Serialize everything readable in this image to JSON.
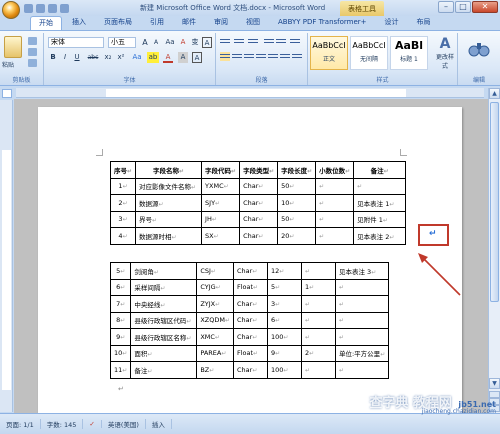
{
  "window": {
    "title": "新建 Microsoft Office Word 文档.docx - Microsoft Word",
    "context_tab_title": "表格工具",
    "minimize": "–",
    "maximize": "□",
    "close": "✕"
  },
  "tabs": [
    "开始",
    "插入",
    "页面布局",
    "引用",
    "邮件",
    "审阅",
    "视图",
    "ABBYY PDF Transformer+",
    "设计",
    "布局"
  ],
  "active_tab": "开始",
  "ribbon": {
    "clipboard": {
      "label": "剪贴板",
      "paste": "粘贴"
    },
    "font": {
      "label": "字体",
      "font_name": "宋体",
      "font_size": "小五",
      "grow": "A",
      "shrink": "A",
      "aa": "Aa",
      "clear": "A",
      "wen": "变",
      "wen2": "A",
      "bold": "B",
      "italic": "I",
      "underline": "U",
      "strike": "abc",
      "sub": "x₂",
      "sup": "x²",
      "effect": "Aa",
      "highlight": "ab",
      "color": "A",
      "char_border": "A",
      "char_shade": "A"
    },
    "paragraph": {
      "label": "段落"
    },
    "styles": {
      "label": "样式",
      "items": [
        {
          "sample": "AaBbCcI",
          "name": "正文",
          "selected": true
        },
        {
          "sample": "AaBbCcI",
          "name": "无间隔",
          "selected": false
        },
        {
          "sample": "AaBl",
          "name": "标题 1",
          "selected": false
        }
      ],
      "change_styles": "更改样式",
      "change_styles_glyph": "A"
    },
    "editing": {
      "label": "编辑"
    }
  },
  "table1": {
    "headers": [
      "序号",
      "字段名称",
      "字段代码",
      "字段类型",
      "字段长度",
      "小数位数",
      "备注"
    ],
    "rows": [
      [
        "1",
        "对应影像文件名称",
        "YXMC",
        "Char",
        "50",
        "",
        ""
      ],
      [
        "2",
        "数据源",
        "SJY",
        "Char",
        "10",
        "",
        "见本表注 1"
      ],
      [
        "3",
        "界号",
        "JH",
        "Char",
        "50",
        "",
        "见附件 1"
      ],
      [
        "4",
        "数据源时相",
        "SX",
        "Char",
        "20",
        "",
        "见本表注 2"
      ]
    ]
  },
  "table2": {
    "rows": [
      [
        "5",
        "剑阅角",
        "CSJ",
        "Char",
        "12",
        "",
        "见本表注 3"
      ],
      [
        "6",
        "采样间隔",
        "CYJG",
        "Float",
        "5",
        "1",
        ""
      ],
      [
        "7",
        "中央经线",
        "ZYJX",
        "Char",
        "3",
        "",
        ""
      ],
      [
        "8",
        "县级行政辖区代码",
        "XZQDM",
        "Char",
        "6",
        "",
        ""
      ],
      [
        "9",
        "县级行政辖区名称",
        "XMC",
        "Char",
        "100",
        "",
        ""
      ],
      [
        "10",
        "面积",
        "PAREA",
        "Float",
        "9",
        "2",
        "单位:平方公里"
      ],
      [
        "11",
        "备注",
        "BZ",
        "Char",
        "100",
        "",
        ""
      ]
    ]
  },
  "marks": {
    "cell_end": "↵",
    "para_end": "↵",
    "cursor": "↵"
  },
  "status": {
    "page": "页面: 1/1",
    "words": "字数: 145",
    "language": "英语(美国)",
    "mode": "插入"
  },
  "scrollbar": {
    "up": "▲",
    "down": "▼"
  },
  "watermark": {
    "main": "查字典 教程网",
    "sub": "jiaocheng.chazidian.com",
    "corner": "jb51.net"
  },
  "colors": {
    "annotation": "#c0392b",
    "ribbon_bg": "#dbe8f7",
    "context_tab": "#e9c86a"
  }
}
